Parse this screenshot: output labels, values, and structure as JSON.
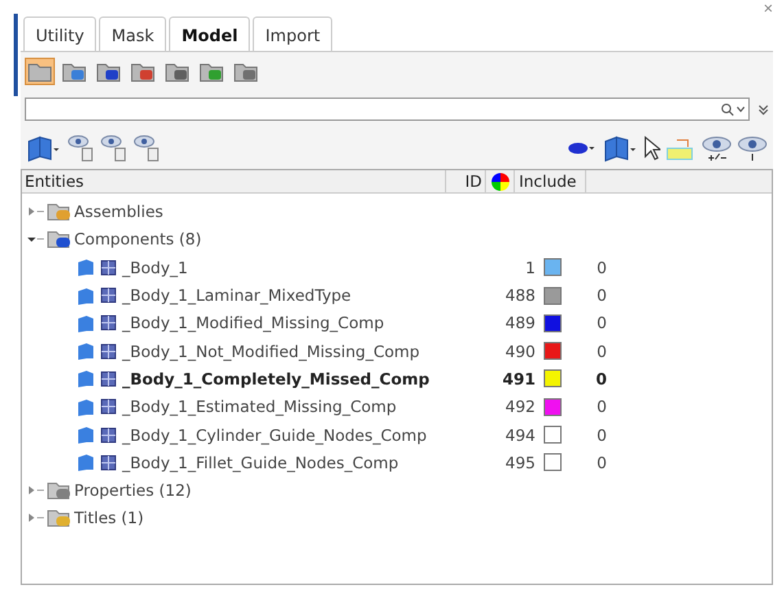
{
  "close_button": "×",
  "tabs": [
    {
      "label": "Utility",
      "selected": false
    },
    {
      "label": "Mask",
      "selected": false
    },
    {
      "label": "Model",
      "selected": true
    },
    {
      "label": "Import",
      "selected": false
    }
  ],
  "toolbar": [
    {
      "kind": "folder",
      "selected": true
    },
    {
      "kind": "connect",
      "selected": false
    },
    {
      "kind": "component",
      "selected": false
    },
    {
      "kind": "load",
      "selected": false
    },
    {
      "kind": "property",
      "selected": false
    },
    {
      "kind": "assembly",
      "selected": false
    },
    {
      "kind": "stack",
      "selected": false
    }
  ],
  "table": {
    "columns": [
      "Entities",
      "ID",
      "Include"
    ],
    "rows": [
      {
        "label": "Assemblies",
        "kind": "assembly",
        "expanded": false
      },
      {
        "label": "Components (8)",
        "kind": "component",
        "expanded": true,
        "children": [
          {
            "label": "_Body_1",
            "id": "1",
            "color": "#6ab4f0",
            "include": "0",
            "current": false
          },
          {
            "label": "_Body_1_Laminar_MixedType",
            "id": "488",
            "color": "#9a9a9a",
            "include": "0",
            "current": false
          },
          {
            "label": "_Body_1_Modified_Missing_Comp",
            "id": "489",
            "color": "#1010e0",
            "include": "0",
            "current": false
          },
          {
            "label": "_Body_1_Not_Modified_Missing_Comp",
            "id": "490",
            "color": "#e81818",
            "include": "0",
            "current": false
          },
          {
            "label": "_Body_1_Completely_Missed_Comp",
            "id": "491",
            "color": "#f4f400",
            "include": "0",
            "current": true
          },
          {
            "label": "_Body_1_Estimated_Missing_Comp",
            "id": "492",
            "color": "#f010f0",
            "include": "0",
            "current": false
          },
          {
            "label": "_Body_1_Cylinder_Guide_Nodes_Comp",
            "id": "494",
            "color": "#ffffff",
            "include": "0",
            "current": false
          },
          {
            "label": "_Body_1_Fillet_Guide_Nodes_Comp",
            "id": "495",
            "color": "#ffffff",
            "include": "0",
            "current": false
          }
        ]
      },
      {
        "label": "Properties (12)",
        "kind": "property",
        "expanded": false
      },
      {
        "label": "Titles (1)",
        "kind": "title",
        "expanded": false
      }
    ]
  }
}
